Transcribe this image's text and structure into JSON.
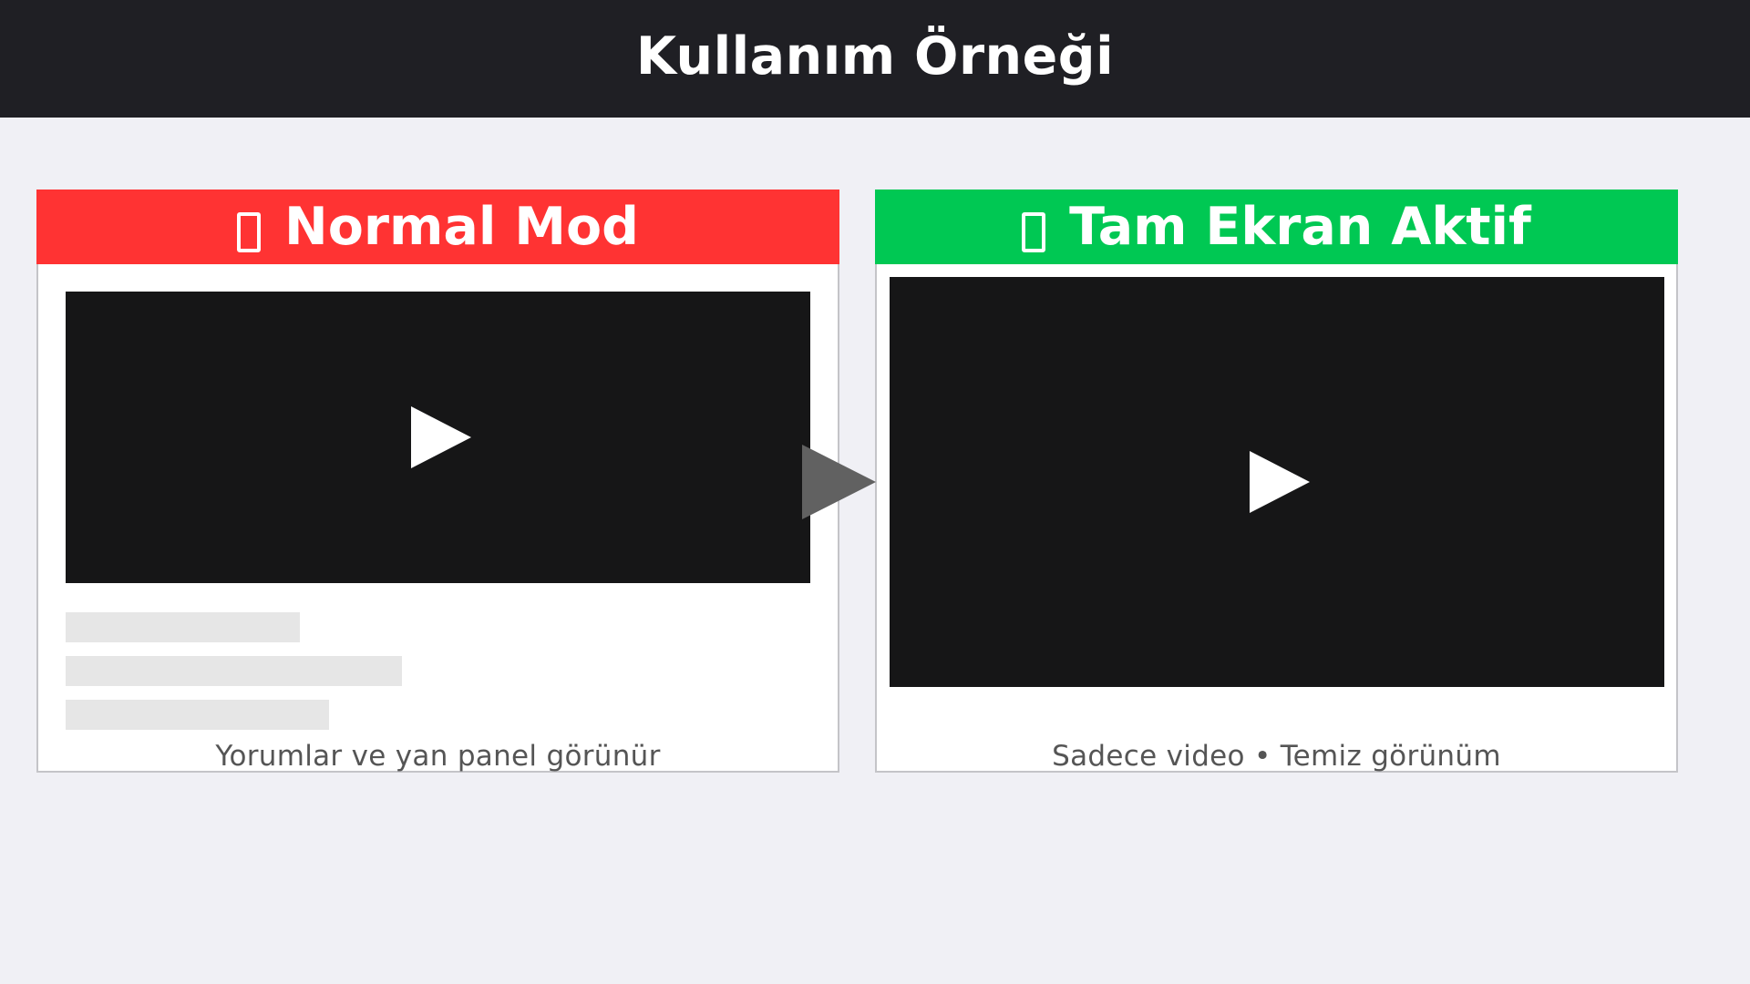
{
  "header": {
    "title": "Kullanım Örneği"
  },
  "panels": [
    {
      "status_label": "Normal Mod",
      "status_color": "#ff3333",
      "caption": "Yorumlar ve yan panel görünür"
    },
    {
      "status_label": "Tam Ekran Aktif",
      "status_color": "#00c853",
      "caption": "Sadece video • Temiz görünüm"
    }
  ],
  "icons": {
    "banner_icon": "box-glyph-icon",
    "play_icon": "play-icon",
    "transition_arrow": "arrow-right-icon"
  },
  "colors": {
    "header_bg": "#1f1f24",
    "page_bg": "#f0f0f5",
    "video_bg": "#161617",
    "placeholder_bar": "#e6e6e6",
    "arrow": "#616161"
  }
}
